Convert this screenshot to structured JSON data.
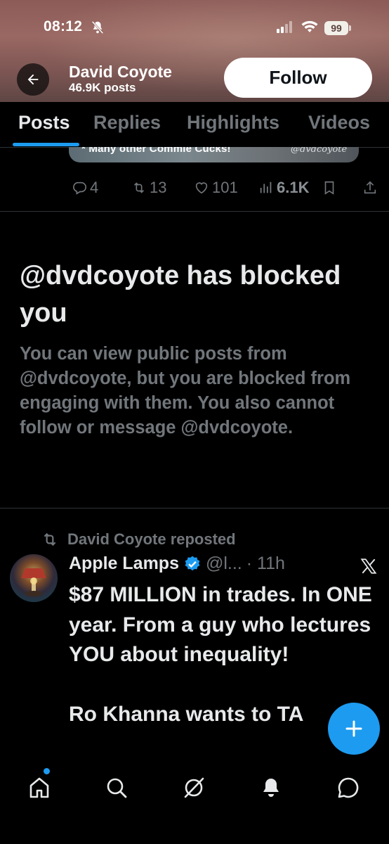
{
  "status_bar": {
    "time": "08:12",
    "battery": "99"
  },
  "header": {
    "name": "David Coyote",
    "posts_count": "46.9K posts",
    "follow_label": "Follow"
  },
  "tabs": [
    {
      "label": "Posts",
      "active": true
    },
    {
      "label": "Replies",
      "active": false
    },
    {
      "label": "Highlights",
      "active": false
    },
    {
      "label": "Videos",
      "active": false
    }
  ],
  "previous_post": {
    "media_caption": "* Many other Commie Cucks!",
    "media_watermark": "@dvdcoyote",
    "replies": "4",
    "reposts": "13",
    "likes": "101",
    "views": "6.1K"
  },
  "blocked_notice": {
    "title": "@dvdcoyote has blocked you",
    "body": "You can view public posts from @dvdcoyote, but you are blocked from engaging with them. You also cannot follow or message @dvdcoyote."
  },
  "repost": {
    "reposted_by": "David Coyote reposted",
    "author_name": "Apple Lamps",
    "author_handle": "@l...",
    "time": "· 11h",
    "text": "$87 MILLION in trades. In ONE year. From a guy who lectures YOU about inequality!\n\nRo Khanna wants to TA"
  },
  "colors": {
    "accent": "#1d9bf0",
    "muted": "#71767b",
    "text": "#e7e9ea",
    "background": "#000000"
  },
  "bottom_nav": [
    "home-icon",
    "search-icon",
    "grok-icon",
    "notifications-bell-icon",
    "messages-icon"
  ]
}
